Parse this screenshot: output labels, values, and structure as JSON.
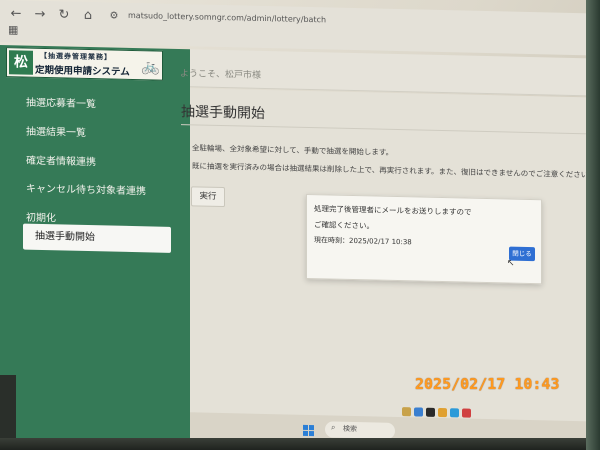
{
  "browser": {
    "url": "matsudo_lottery.somngr.com/admin/lottery/batch",
    "back_icon": "arrow-left-icon",
    "forward_icon": "arrow-right-icon",
    "reload_icon": "reload-icon",
    "home_icon": "home-icon",
    "apps_icon": "apps-grid-icon"
  },
  "sidebar": {
    "logo": {
      "mark": "松",
      "small": "【抽選券管理業務】",
      "title": "定期使用申請システム"
    },
    "items": [
      {
        "label": "抽選応募者一覧"
      },
      {
        "label": "抽選結果一覧"
      },
      {
        "label": "確定者情報連携"
      },
      {
        "label": "キャンセル待ち対象者連携"
      },
      {
        "label": "初期化"
      },
      {
        "label": "抽選手動開始",
        "active": true
      }
    ]
  },
  "header": {
    "welcome": "ようこそ、松戸市様"
  },
  "main": {
    "title": "抽選手動開始",
    "description_1": "全駐輪場、全対象希望に対して、手動で抽選を開始します。",
    "description_2": "既に抽選を実行済みの場合は抽選結果は削除した上で、再実行されます。また、復旧はできませんのでご注意ください。",
    "execute_label": "実行"
  },
  "modal": {
    "message_1": "処理完了後管理者にメールをお送りしますので",
    "message_2": "ご確認ください。",
    "time_line": "現在時刻：2025/02/17 10:38",
    "close_label": "閉じる"
  },
  "taskbar": {
    "search_label": "検索"
  },
  "photo_stamp": "2025/02/17  10:43",
  "colors": {
    "sidebar": "#357a57",
    "close_button": "#2f6fd3",
    "stamp": "#ff9a1f"
  }
}
